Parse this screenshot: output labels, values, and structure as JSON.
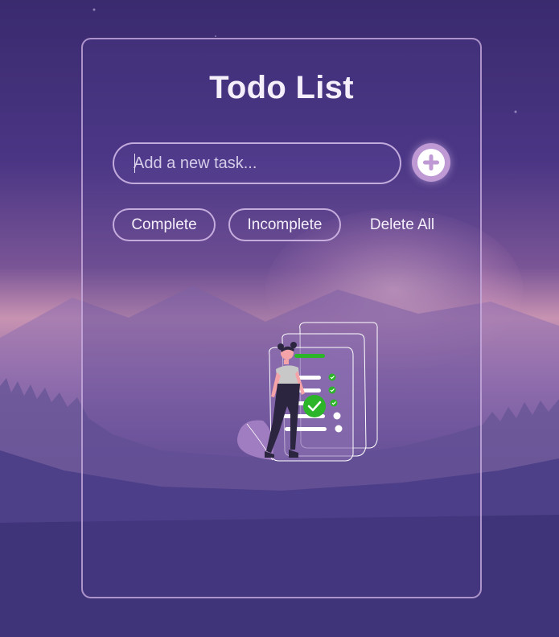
{
  "app": {
    "title": "Todo List"
  },
  "new_task": {
    "placeholder": "Add a new task...",
    "value": ""
  },
  "add_button": {
    "icon": "plus-icon"
  },
  "filters": {
    "complete_label": "Complete",
    "incomplete_label": "Incomplete",
    "delete_all_label": "Delete All"
  },
  "empty_state": {
    "illustration": "woman-with-checklist-illustration"
  },
  "colors": {
    "accent": "#bf99d4",
    "check_green": "#2db52a",
    "text": "#f4effa",
    "card_border": "#d2b4e6"
  }
}
